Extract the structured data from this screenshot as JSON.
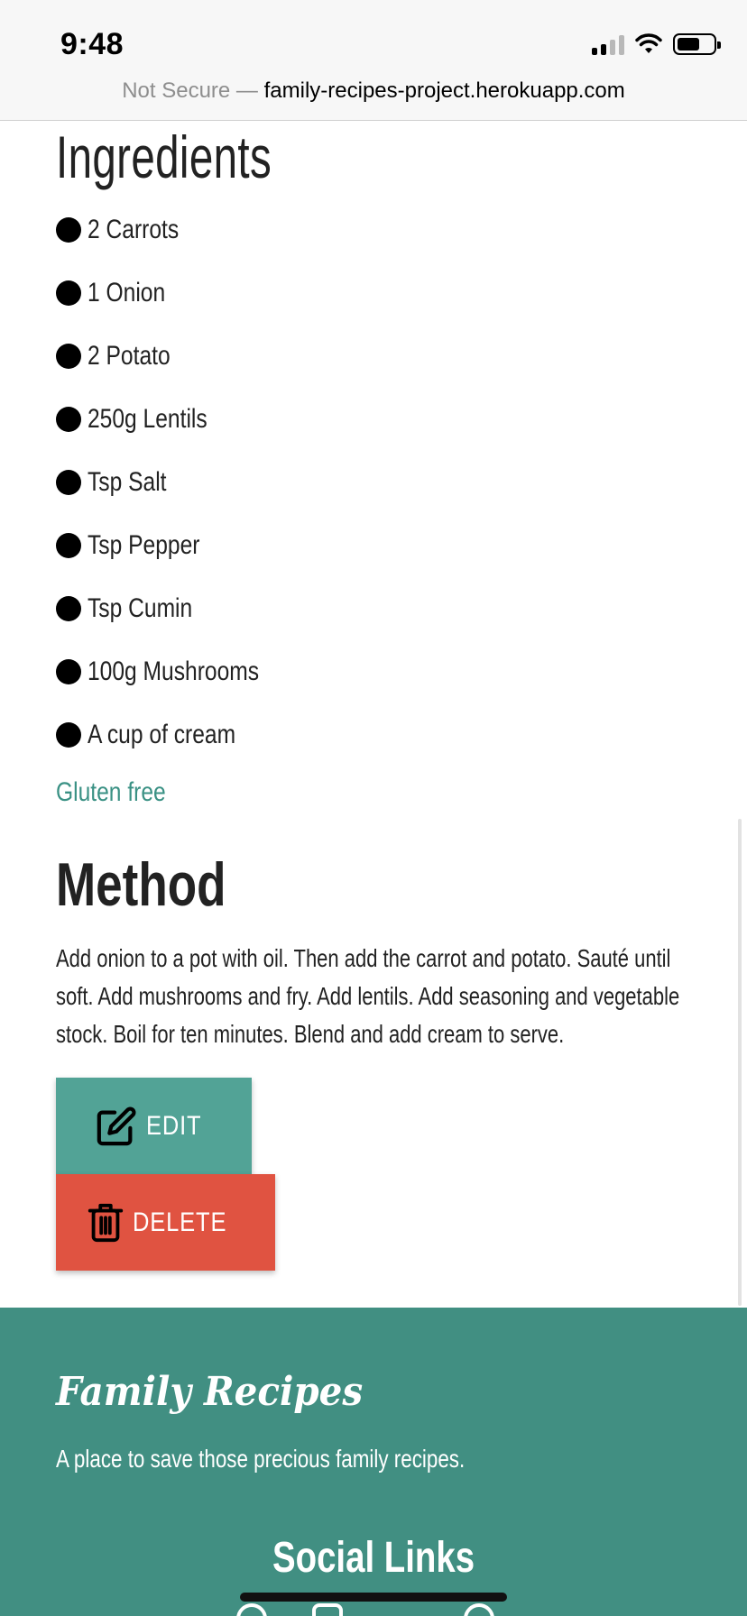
{
  "status_bar": {
    "time": "9:48"
  },
  "browser": {
    "security_label": "Not Secure —",
    "domain": "family-recipes-project.herokuapp.com"
  },
  "recipe": {
    "ingredients_heading": "Ingredients",
    "ingredients": [
      "2 Carrots",
      "1 Onion",
      "2 Potato",
      "250g Lentils",
      "Tsp Salt",
      "Tsp Pepper",
      "Tsp Cumin",
      "100g Mushrooms",
      "A cup of cream"
    ],
    "dietary_tag": "Gluten free",
    "method_heading": "Method",
    "method_text": "Add onion to a pot with oil. Then add the carrot and potato. Sauté until soft. Add mushrooms and fry. Add lentils. Add seasoning and vegetable stock. Boil for ten minutes. Blend and add cream to serve.",
    "edit_label": "EDIT",
    "delete_label": "DELETE"
  },
  "footer": {
    "brand": "Family Recipes",
    "tagline": "A place to save those precious family recipes.",
    "social_title": "Social Links"
  },
  "colors": {
    "accent": "#52a396",
    "delete": "#e05341",
    "footer_bg": "#418f82",
    "tag_text": "#3a9184"
  }
}
